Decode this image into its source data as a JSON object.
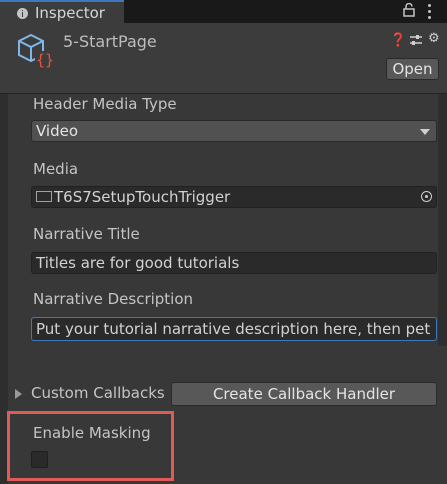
{
  "tab": {
    "title": "Inspector"
  },
  "header": {
    "object_name": "5-StartPage",
    "open_label": "Open",
    "icons": [
      "help-icon",
      "preset-icon",
      "settings-icon"
    ]
  },
  "fields": {
    "header_media_type": {
      "label": "Header Media Type",
      "value": "Video"
    },
    "media": {
      "label": "Media",
      "value": "T6S7SetupTouchTrigger"
    },
    "narrative_title": {
      "label": "Narrative Title",
      "value": "Titles are for good tutorials"
    },
    "narrative_description": {
      "label": "Narrative Description",
      "value": "Put your tutorial narrative description here, then pet a dog"
    }
  },
  "callbacks": {
    "label": "Custom Callbacks",
    "button_label": "Create Callback Handler"
  },
  "masking": {
    "label": "Enable Masking",
    "checked": false
  },
  "colors": {
    "accent": "#3a79bb",
    "highlight": "#e05a56"
  }
}
